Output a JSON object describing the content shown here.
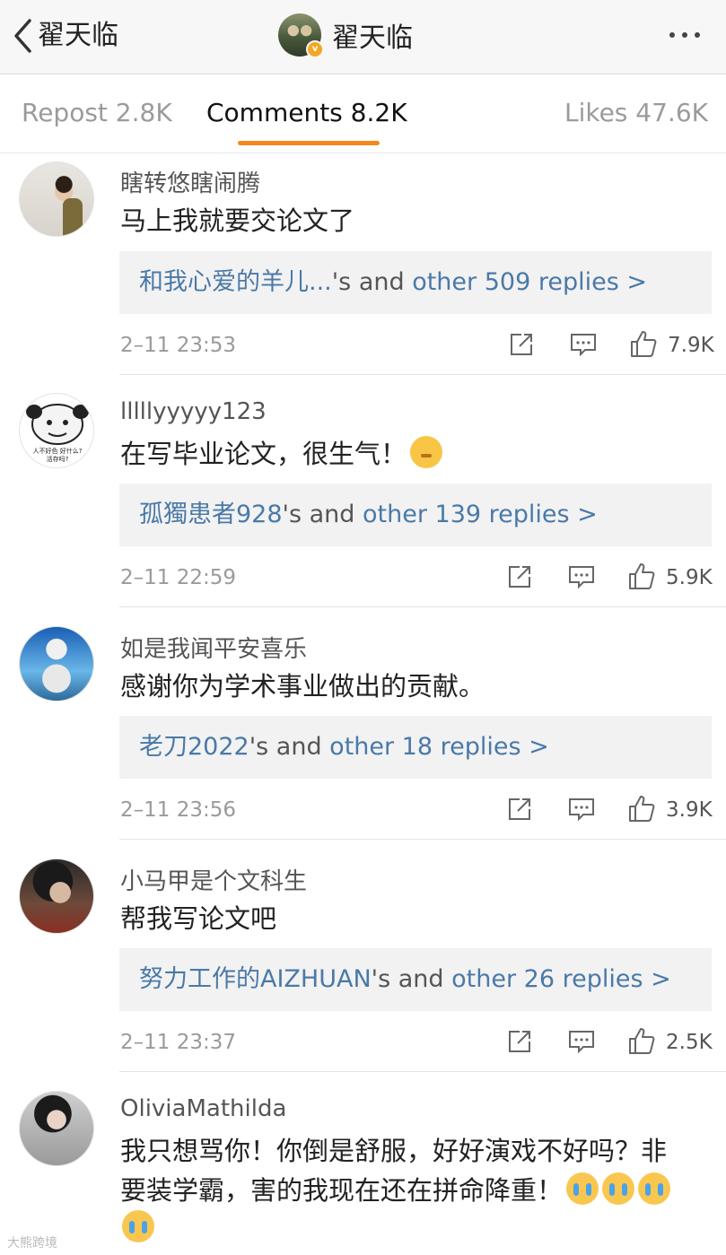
{
  "header": {
    "back_label": "翟天临",
    "title": "翟天临",
    "verified_badge": "v"
  },
  "tabs": [
    {
      "label": "Repost 2.8K",
      "active": false
    },
    {
      "label": "Comments 8.2K",
      "active": true
    },
    {
      "label": "Likes 47.6K",
      "active": false
    }
  ],
  "colors": {
    "accent": "#f28a1f",
    "link": "#4a79a8",
    "verified": "#f5a623"
  },
  "comments": [
    {
      "username": "瞎转悠瞎闹腾",
      "text": "马上我就要交论文了",
      "reply_user": "和我心爱的羊儿...",
      "reply_mid": "'s and ",
      "reply_more": "other 509 replies >",
      "time": "2–11 23:53",
      "likes": "7.9K"
    },
    {
      "username": "lllllyyyyy123",
      "text": "在写毕业论文，很生气！",
      "reply_user": "孤獨患者928",
      "reply_mid": "'s and ",
      "reply_more": "other 139 replies >",
      "time": "2–11 22:59",
      "likes": "5.9K",
      "avatar_caption_1": "人不好色 好什么?",
      "avatar_caption_2": "活存吗?"
    },
    {
      "username": "如是我闻平安喜乐",
      "text": "感谢你为学术事业做出的贡献。",
      "reply_user": "老刀2022",
      "reply_mid": "'s and ",
      "reply_more": "other 18 replies >",
      "time": "2–11 23:56",
      "likes": "3.9K"
    },
    {
      "username": "小马甲是个文科生",
      "text": "帮我写论文吧",
      "reply_user": "努力工作的AIZHUAN",
      "reply_mid": "'s and ",
      "reply_more": "other 26 replies >",
      "time": "2–11 23:37",
      "likes": "2.5K"
    },
    {
      "username": "OliviaMathilda",
      "text_line1": "我只想骂你！你倒是舒服，好好演戏不好吗？非",
      "text_line2": "要装学霸，害的我现在还在拼命降重！"
    }
  ],
  "watermark": "大熊跨境"
}
